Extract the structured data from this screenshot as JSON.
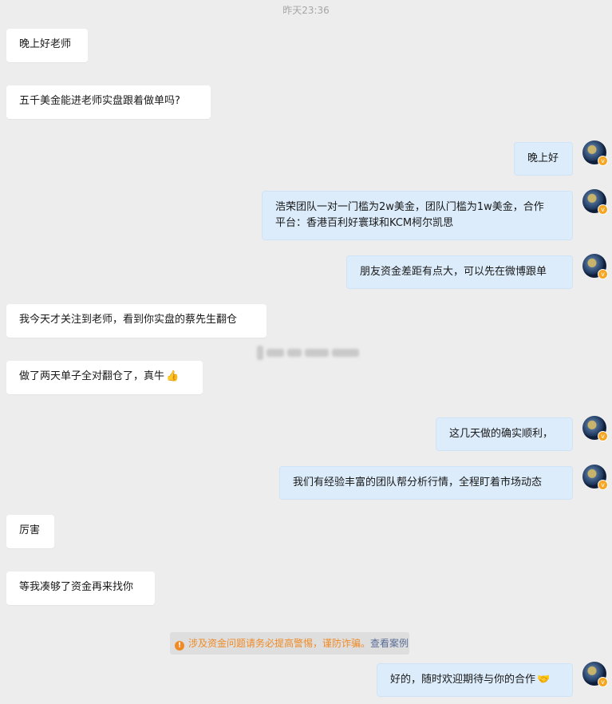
{
  "timestamp": "昨天23:36",
  "messages": [
    {
      "side": "left",
      "text": "晚上好老师"
    },
    {
      "side": "left",
      "text": "五千美金能进老师实盘跟着做单吗?"
    },
    {
      "side": "right",
      "text": "晚上好"
    },
    {
      "side": "right",
      "line1": "浩荣团队一对一门槛为2w美金，团队门槛为1w美金，合作",
      "line2": "平台：香港百利好寰球和KCM柯尔凯思"
    },
    {
      "side": "right",
      "text": "朋友资金差距有点大，可以先在微博跟单"
    },
    {
      "side": "left",
      "text": "我今天才关注到老师，看到你实盘的蔡先生翻仓"
    },
    {
      "side": "left",
      "text": "做了两天单子全对翻仓了，真牛",
      "emoji": "👍"
    },
    {
      "side": "right",
      "text": "这几天做的确实顺利，"
    },
    {
      "side": "right",
      "text": "我们有经验丰富的团队帮分析行情，全程盯着市场动态"
    },
    {
      "side": "left",
      "text": "厉害"
    },
    {
      "side": "left",
      "text": "等我凑够了资金再来找你"
    },
    {
      "side": "right",
      "text": "好的，随时欢迎期待与你的合作",
      "emoji": "🤝"
    }
  ],
  "warning": {
    "icon": "warning-icon",
    "text": "涉及资金问题请务必提高警惕，谨防诈骗。",
    "link": "查看案例"
  },
  "colors": {
    "background": "#ededed",
    "left_bubble": "#ffffff",
    "right_bubble": "#dcecfb",
    "warning_text": "#f08a24",
    "link": "#576b95"
  }
}
